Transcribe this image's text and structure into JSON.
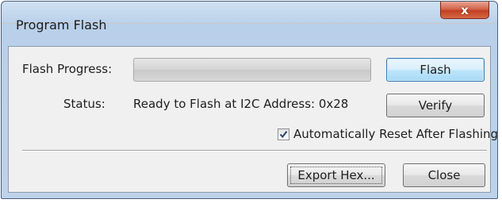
{
  "window": {
    "title": "Program Flash",
    "close_glyph": "x"
  },
  "progress": {
    "label": "Flash Progress:",
    "value": 0
  },
  "status": {
    "label": "Status:",
    "text": "Ready to Flash at I2C Address: 0x28"
  },
  "buttons": {
    "flash": "Flash",
    "verify": "Verify",
    "export_hex": "Export Hex...",
    "close": "Close"
  },
  "auto_reset": {
    "label": "Automatically Reset After Flashing",
    "checked": true
  },
  "icons": {
    "close": "close-icon",
    "check": "checkmark-icon"
  }
}
